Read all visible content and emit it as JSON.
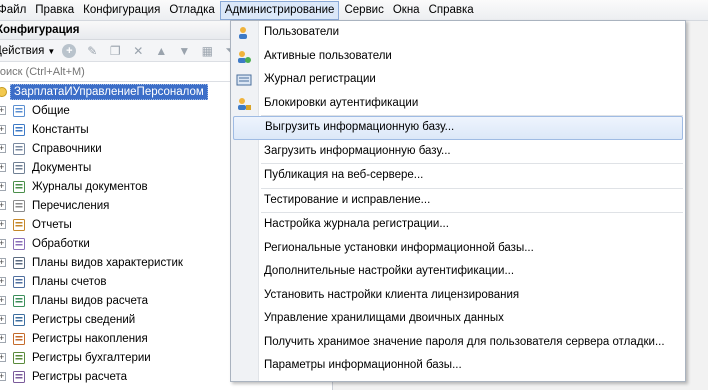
{
  "menubar": {
    "items": [
      "Файл",
      "Правка",
      "Конфигурация",
      "Отладка",
      "Администрирование",
      "Сервис",
      "Окна",
      "Справка"
    ],
    "active_index": 4
  },
  "config_pane": {
    "title": "Конфигурация",
    "toolbar": {
      "actions_label": "Действия"
    },
    "search": {
      "placeholder": "Поиск (Ctrl+Alt+M)"
    },
    "root": "ЗарплатаИУправлениеПерсоналом",
    "items": [
      {
        "label": "Общие",
        "icon": "common-icon"
      },
      {
        "label": "Константы",
        "icon": "constants-icon"
      },
      {
        "label": "Справочники",
        "icon": "catalogs-icon"
      },
      {
        "label": "Документы",
        "icon": "documents-icon"
      },
      {
        "label": "Журналы документов",
        "icon": "journals-icon"
      },
      {
        "label": "Перечисления",
        "icon": "enums-icon"
      },
      {
        "label": "Отчеты",
        "icon": "reports-icon"
      },
      {
        "label": "Обработки",
        "icon": "processing-icon"
      },
      {
        "label": "Планы видов характеристик",
        "icon": "chart-char-types-icon"
      },
      {
        "label": "Планы счетов",
        "icon": "chart-accounts-icon"
      },
      {
        "label": "Планы видов расчета",
        "icon": "chart-calc-types-icon"
      },
      {
        "label": "Регистры сведений",
        "icon": "info-registers-icon"
      },
      {
        "label": "Регистры накопления",
        "icon": "accum-registers-icon"
      },
      {
        "label": "Регистры бухгалтерии",
        "icon": "account-registers-icon"
      },
      {
        "label": "Регистры расчета",
        "icon": "calc-registers-icon"
      }
    ]
  },
  "admin_menu": {
    "group1": [
      {
        "label": "Пользователи",
        "icon": "user-icon"
      },
      {
        "label": "Активные пользователи",
        "icon": "active-users-icon"
      },
      {
        "label": "Журнал регистрации",
        "icon": "event-log-icon"
      },
      {
        "label": "Блокировки аутентификации",
        "icon": "auth-lock-icon"
      }
    ],
    "group2": [
      "Выгрузить информационную базу...",
      "Загрузить информационную базу..."
    ],
    "group3": [
      "Публикация на веб-сервере..."
    ],
    "group4": [
      "Тестирование и исправление..."
    ],
    "group5": [
      "Настройка журнала регистрации...",
      "Региональные установки информационной базы...",
      "Дополнительные настройки аутентификации...",
      "Установить настройки клиента лицензирования",
      "Управление хранилищами двоичных данных",
      "Получить хранимое значение пароля для пользователя сервера отладки...",
      "Параметры информационной базы..."
    ],
    "highlighted": "Выгрузить информационную базу..."
  }
}
